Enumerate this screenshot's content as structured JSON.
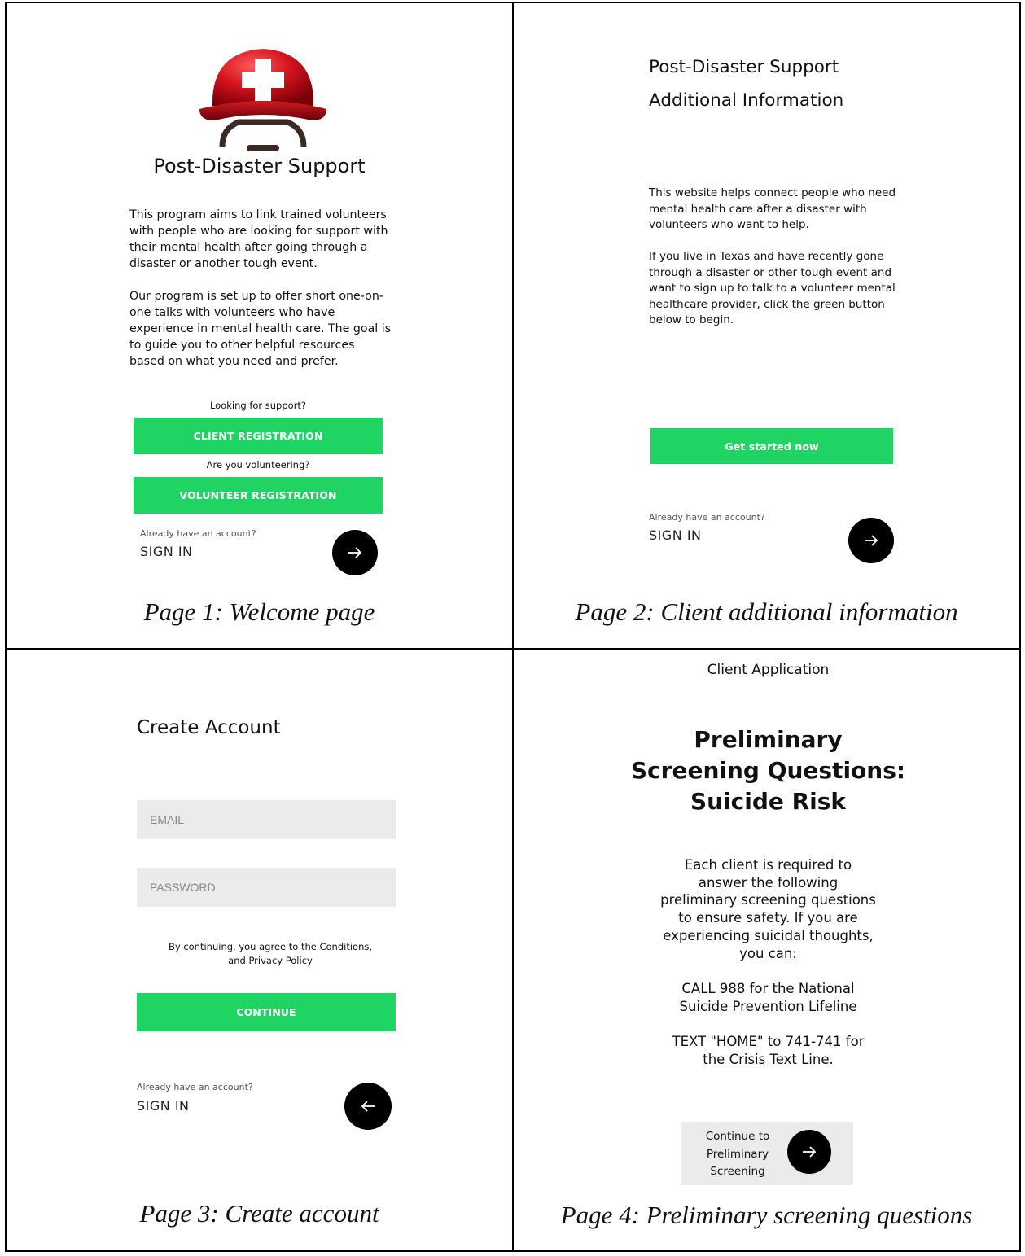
{
  "page1": {
    "title": "Post-Disaster Support",
    "paragraph1": "This program aims to link trained volunteers with people who are looking for support with their mental health after going through a disaster or another tough event.",
    "paragraph2": "Our program is set up to offer short one-on-one talks with volunteers who have experience in mental health care. The goal is to guide you to other helpful resources based on what you need and prefer.",
    "support_prompt": "Looking for support?",
    "client_button": "CLIENT REGISTRATION",
    "volunteer_prompt": "Are you volunteering?",
    "volunteer_button": "VOLUNTEER REGISTRATION",
    "account_prompt": "Already have an account?",
    "sign_in": "SIGN IN",
    "caption": "Page 1: Welcome page"
  },
  "page2": {
    "title_line1": "Post-Disaster Support",
    "title_line2": "Additional Information",
    "paragraph1": "This website helps connect people who need mental health care after a disaster with volunteers who want to help.",
    "paragraph2": "If you live in Texas and have recently gone through a disaster or other tough event and want to sign up to talk to a volunteer mental healthcare provider, click the green button below to begin.",
    "start_button": "Get started now",
    "account_prompt": "Already have an account?",
    "sign_in": "SIGN IN",
    "caption": "Page 2: Client additional information"
  },
  "page3": {
    "title": "Create Account",
    "email_placeholder": "EMAIL",
    "password_placeholder": "PASSWORD",
    "terms_line1": "By continuing, you agree to the Conditions,",
    "terms_line2": "and Privacy Policy",
    "continue_button": "CONTINUE",
    "account_prompt": "Already have an account?",
    "sign_in": "SIGN IN",
    "caption": "Page 3: Create account"
  },
  "page4": {
    "header": "Client Application",
    "title_line1": "Preliminary",
    "title_line2": "Screening Questions:",
    "title_line3": "Suicide Risk",
    "paragraph1": "Each client is required to answer the following preliminary screening questions to ensure safety. If you are experiencing suicidal thoughts, you can:",
    "call_line": "CALL 988 for the National Suicide Prevention Lifeline",
    "text_line": "TEXT \"HOME\" to 741-741 for the Crisis Text Line.",
    "continue_label": "Continue to Preliminary Screening",
    "caption": "Page 4: Preliminary screening questions"
  },
  "colors": {
    "accent_green": "#1fd463",
    "input_gray": "#ebebeb",
    "button_black": "#000000",
    "helmet_red": "#c8101a"
  },
  "icons": {
    "logo": "red-helmet-with-white-cross-icon",
    "forward": "arrow-right-icon",
    "back": "arrow-left-icon"
  }
}
